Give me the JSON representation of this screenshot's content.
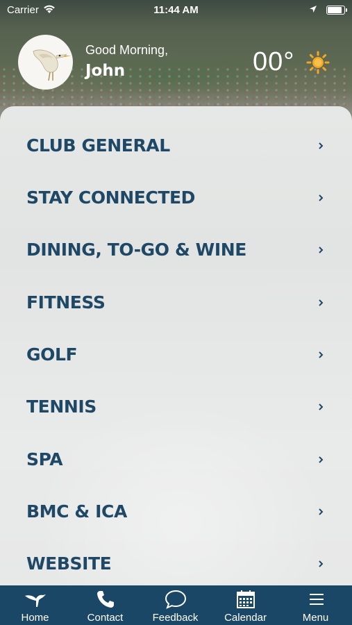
{
  "status_bar": {
    "carrier": "Carrier",
    "time": "11:44 AM",
    "battery_level": 0.95
  },
  "header": {
    "greeting": "Good Morning,",
    "user_name": "John",
    "temperature": "00°",
    "weather_icon": "sun-icon",
    "avatar_icon": "egret-logo"
  },
  "menu": {
    "items": [
      {
        "label": "CLUB GENERAL"
      },
      {
        "label": "STAY CONNECTED"
      },
      {
        "label": "DINING, TO-GO & WINE"
      },
      {
        "label": "FITNESS"
      },
      {
        "label": "GOLF"
      },
      {
        "label": "TENNIS"
      },
      {
        "label": "SPA"
      },
      {
        "label": "BMC & ICA"
      },
      {
        "label": "WEBSITE"
      }
    ]
  },
  "tab_bar": {
    "tabs": [
      {
        "label": "Home",
        "icon": "bird-icon"
      },
      {
        "label": "Contact",
        "icon": "phone-icon"
      },
      {
        "label": "Feedback",
        "icon": "chat-bubble-icon"
      },
      {
        "label": "Calendar",
        "icon": "calendar-icon"
      },
      {
        "label": "Menu",
        "icon": "hamburger-icon"
      }
    ]
  },
  "colors": {
    "brand": "#1b4766",
    "menu_text": "#1f4866",
    "sun": "#f5a623"
  }
}
